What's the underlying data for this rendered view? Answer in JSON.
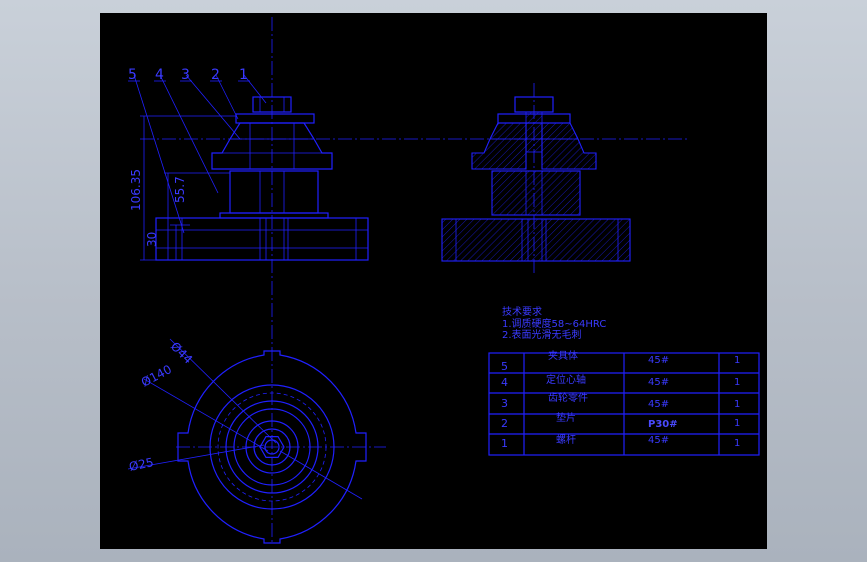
{
  "drawing": {
    "colors": {
      "background": "#000000",
      "lines": "#2020ff",
      "text": "#3a3aff",
      "window": "#b9c0ca"
    },
    "balloons": [
      "5",
      "4",
      "3",
      "2",
      "1"
    ],
    "dimensions": {
      "total_height": "106.35",
      "height_55": "55.7",
      "height_30": "30",
      "dia_44": "Ø44",
      "dia_140": "Ø140",
      "dia_25": "Ø25"
    },
    "tech": {
      "title": "技术要求",
      "req1": "1.调质硬度58~64HRC",
      "req2": "2.表面光滑无毛刺"
    },
    "bom": [
      {
        "no": "5",
        "name": "夹具体",
        "material": "45#",
        "qty": "1"
      },
      {
        "no": "4",
        "name": "定位心轴",
        "material": "45#",
        "qty": "1"
      },
      {
        "no": "3",
        "name": "齿轮零件",
        "material": "45#",
        "qty": "1"
      },
      {
        "no": "2",
        "name": "垫片",
        "material": "P30#",
        "qty": "1"
      },
      {
        "no": "1",
        "name": "螺杆",
        "material": "45#",
        "qty": "1"
      }
    ]
  }
}
